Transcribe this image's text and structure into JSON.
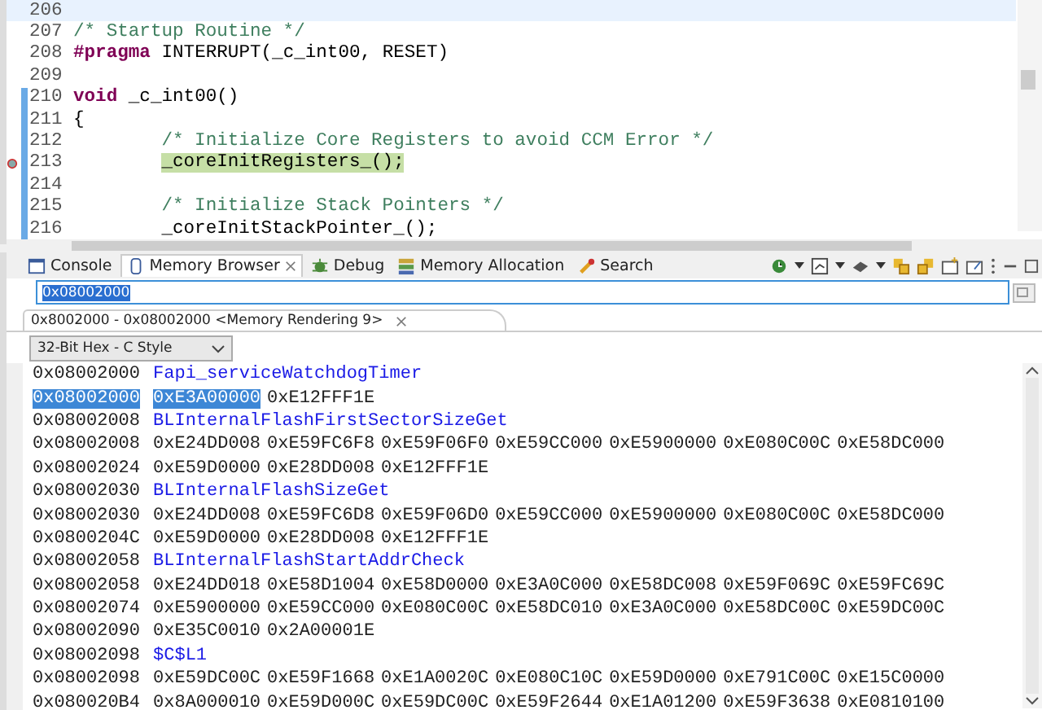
{
  "editor": {
    "lines": [
      {
        "number": "206",
        "current": true,
        "highlighted": false,
        "changed": false,
        "debug_pointer": false
      },
      {
        "number": "207",
        "current": false,
        "highlighted": false,
        "changed": false,
        "debug_pointer": false,
        "tokens": [
          {
            "kind": "comment",
            "text": "/* Startup Routine */"
          }
        ]
      },
      {
        "number": "208",
        "current": false,
        "highlighted": false,
        "changed": false,
        "debug_pointer": false,
        "tokens": [
          {
            "kind": "keyword",
            "text": "#pragma"
          },
          {
            "kind": "plain",
            "text": " INTERRUPT(_c_int00, RESET)"
          }
        ]
      },
      {
        "number": "209",
        "current": false,
        "highlighted": false,
        "changed": false,
        "debug_pointer": false
      },
      {
        "number": "210",
        "current": false,
        "highlighted": false,
        "changed": true,
        "debug_pointer": false,
        "tokens": [
          {
            "kind": "keyword",
            "text": "void"
          },
          {
            "kind": "plain",
            "text": " _c_int00()"
          }
        ]
      },
      {
        "number": "211",
        "current": false,
        "highlighted": false,
        "changed": true,
        "debug_pointer": false,
        "tokens": [
          {
            "kind": "plain",
            "text": "{"
          }
        ]
      },
      {
        "number": "212",
        "current": false,
        "highlighted": false,
        "changed": true,
        "debug_pointer": false,
        "indented": true,
        "tokens": [
          {
            "kind": "comment",
            "text": "/* Initialize Core Registers to avoid CCM Error */"
          }
        ]
      },
      {
        "number": "213",
        "current": false,
        "highlighted": true,
        "changed": true,
        "debug_pointer": true,
        "indented": true,
        "tokens": [
          {
            "kind": "plain",
            "text": "_coreInitRegisters_();"
          }
        ]
      },
      {
        "number": "214",
        "current": false,
        "highlighted": false,
        "changed": true,
        "debug_pointer": false
      },
      {
        "number": "215",
        "current": false,
        "highlighted": false,
        "changed": true,
        "debug_pointer": false,
        "indented": true,
        "tokens": [
          {
            "kind": "comment",
            "text": "/* Initialize Stack Pointers */"
          }
        ]
      },
      {
        "number": "216",
        "current": false,
        "highlighted": false,
        "changed": true,
        "debug_pointer": false,
        "indented": true,
        "tokens": [
          {
            "kind": "plain",
            "text": "_coreInitStackPointer_();"
          }
        ]
      }
    ]
  },
  "tabs": [
    {
      "label": "Console",
      "kind": "console",
      "selected": false,
      "closable": false
    },
    {
      "label": "Memory Browser",
      "kind": "memory",
      "selected": true,
      "closable": true
    },
    {
      "label": "Debug",
      "kind": "debug",
      "selected": false,
      "closable": false
    },
    {
      "label": "Memory Allocation",
      "kind": "allocation",
      "selected": false,
      "closable": false
    },
    {
      "label": "Search",
      "kind": "search",
      "selected": false,
      "closable": false
    }
  ],
  "address_field": {
    "value": "0x08002000"
  },
  "rendering_tab": {
    "label": "0x8002000 - 0x08002000 <Memory Rendering 9>"
  },
  "format_select": {
    "value": "32-Bit Hex - C Style"
  },
  "memory_rows": [
    {
      "address": "0x08002000",
      "address_selected": false,
      "kind": "label",
      "label": "Fapi_serviceWatchdogTimer"
    },
    {
      "address": "0x08002000",
      "address_selected": true,
      "kind": "data",
      "words": [
        {
          "text": "0xE3A00000",
          "selected": true
        },
        {
          "text": "0xE12FFF1E",
          "selected": false
        }
      ]
    },
    {
      "address": "0x08002008",
      "address_selected": false,
      "kind": "label",
      "label": "BLInternalFlashFirstSectorSizeGet"
    },
    {
      "address": "0x08002008",
      "address_selected": false,
      "kind": "data",
      "words": [
        {
          "text": "0xE24DD008",
          "selected": false
        },
        {
          "text": "0xE59FC6F8",
          "selected": false
        },
        {
          "text": "0xE59F06F0",
          "selected": false
        },
        {
          "text": "0xE59CC000",
          "selected": false
        },
        {
          "text": "0xE5900000",
          "selected": false
        },
        {
          "text": "0xE080C00C",
          "selected": false
        },
        {
          "text": "0xE58DC000",
          "selected": false
        }
      ]
    },
    {
      "address": "0x08002024",
      "address_selected": false,
      "kind": "data",
      "words": [
        {
          "text": "0xE59D0000",
          "selected": false
        },
        {
          "text": "0xE28DD008",
          "selected": false
        },
        {
          "text": "0xE12FFF1E",
          "selected": false
        }
      ]
    },
    {
      "address": "0x08002030",
      "address_selected": false,
      "kind": "label",
      "label": "BLInternalFlashSizeGet"
    },
    {
      "address": "0x08002030",
      "address_selected": false,
      "kind": "data",
      "words": [
        {
          "text": "0xE24DD008",
          "selected": false
        },
        {
          "text": "0xE59FC6D8",
          "selected": false
        },
        {
          "text": "0xE59F06D0",
          "selected": false
        },
        {
          "text": "0xE59CC000",
          "selected": false
        },
        {
          "text": "0xE5900000",
          "selected": false
        },
        {
          "text": "0xE080C00C",
          "selected": false
        },
        {
          "text": "0xE58DC000",
          "selected": false
        }
      ]
    },
    {
      "address": "0x0800204C",
      "address_selected": false,
      "kind": "data",
      "words": [
        {
          "text": "0xE59D0000",
          "selected": false
        },
        {
          "text": "0xE28DD008",
          "selected": false
        },
        {
          "text": "0xE12FFF1E",
          "selected": false
        }
      ]
    },
    {
      "address": "0x08002058",
      "address_selected": false,
      "kind": "label",
      "label": "BLInternalFlashStartAddrCheck"
    },
    {
      "address": "0x08002058",
      "address_selected": false,
      "kind": "data",
      "words": [
        {
          "text": "0xE24DD018",
          "selected": false
        },
        {
          "text": "0xE58D1004",
          "selected": false
        },
        {
          "text": "0xE58D0000",
          "selected": false
        },
        {
          "text": "0xE3A0C000",
          "selected": false
        },
        {
          "text": "0xE58DC008",
          "selected": false
        },
        {
          "text": "0xE59F069C",
          "selected": false
        },
        {
          "text": "0xE59FC69C",
          "selected": false
        }
      ]
    },
    {
      "address": "0x08002074",
      "address_selected": false,
      "kind": "data",
      "words": [
        {
          "text": "0xE5900000",
          "selected": false
        },
        {
          "text": "0xE59CC000",
          "selected": false
        },
        {
          "text": "0xE080C00C",
          "selected": false
        },
        {
          "text": "0xE58DC010",
          "selected": false
        },
        {
          "text": "0xE3A0C000",
          "selected": false
        },
        {
          "text": "0xE58DC00C",
          "selected": false
        },
        {
          "text": "0xE59DC00C",
          "selected": false
        }
      ]
    },
    {
      "address": "0x08002090",
      "address_selected": false,
      "kind": "data",
      "words": [
        {
          "text": "0xE35C0010",
          "selected": false
        },
        {
          "text": "0x2A00001E",
          "selected": false
        }
      ]
    },
    {
      "address": "0x08002098",
      "address_selected": false,
      "kind": "label",
      "label": "$C$L1"
    },
    {
      "address": "0x08002098",
      "address_selected": false,
      "kind": "data",
      "words": [
        {
          "text": "0xE59DC00C",
          "selected": false
        },
        {
          "text": "0xE59F1668",
          "selected": false
        },
        {
          "text": "0xE1A0020C",
          "selected": false
        },
        {
          "text": "0xE080C10C",
          "selected": false
        },
        {
          "text": "0xE59D0000",
          "selected": false
        },
        {
          "text": "0xE791C00C",
          "selected": false
        },
        {
          "text": "0xE15C0000",
          "selected": false
        }
      ]
    },
    {
      "address": "0x080020B4",
      "address_selected": false,
      "kind": "data",
      "words": [
        {
          "text": "0x8A000010",
          "selected": false
        },
        {
          "text": "0xE59D000C",
          "selected": false
        },
        {
          "text": "0xE59DC00C",
          "selected": false
        },
        {
          "text": "0xE59F2644",
          "selected": false
        },
        {
          "text": "0xE1A01200",
          "selected": false
        },
        {
          "text": "0xE59F3638",
          "selected": false
        },
        {
          "text": "0xE0810100",
          "selected": false
        }
      ]
    }
  ]
}
